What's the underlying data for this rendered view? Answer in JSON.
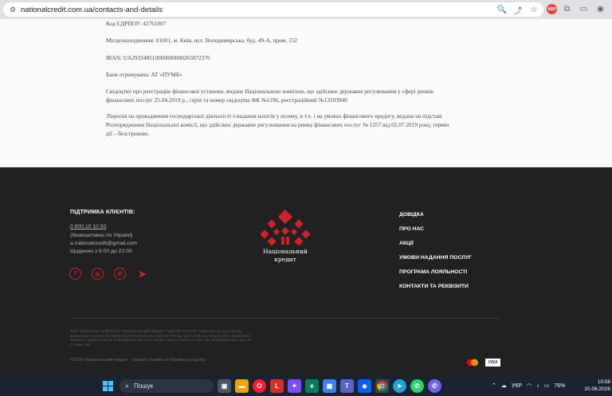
{
  "browser": {
    "url": "nationalcredit.com.ua/contacts-and-details"
  },
  "content": {
    "paragraphs": [
      "Код ЄДРПОУ: 42761807",
      "Місцезнаходження: 01001, м. Київ, вул. Володимирська, буд. 49-А, прим. 152",
      "IBAN: UA293348510000000000265072376",
      "Банк отримувача: АТ «ПУМБ»",
      "Свідоцтво про реєстрацію фінансової установи, видане Національною комісією, що здійснює державне регулювання у сфері ринків фінансових послуг 25.04.2019 р., серія та номер свідоцтва ФК №1196, реєстраційний №13103940",
      "Ліцензія на провадження господарської діяльності з надання коштів у позику, в т.ч. і на умовах фінансового кредиту, видана на підставі Розпорядження Національної комісії, що здійснює державне регулювання на ринку фінансових послуг № 1257 від 02.07.2019 року, термін дії – безстроково."
    ]
  },
  "footer": {
    "support_title": "ПІДТРИМКА КЛІЄНТІВ:",
    "phone": "0 800 10 10 50",
    "phone_note": "(безкоштовно по Україні)",
    "email": "a.nationalcredit@gmail.com",
    "hours": "Щоденно з 8:00 до 22:00",
    "socials": [
      "facebook-icon",
      "instagram-icon",
      "viber-icon",
      "telegram-icon"
    ],
    "logo_line1": "Національний",
    "logo_line2": "кредит",
    "menu": [
      "ДОВІДКА",
      "ПРО НАС",
      "АКЦІЇ",
      "УМОВИ НАДАННЯ ПОСЛУГ",
      "ПРОГРАМА ЛОЯЛЬНОСТІ",
      "КОНТАКТИ ТА РЕКВІЗИТИ"
    ],
    "legal_text": "ТОВ \"ФІНАНСОВА КОМПАНІЯ \"НАЦІОНАЛЬНИЙ КРЕДИТ\" ЄДРПОУ 42761807 Свідоцтво про реєстрацію фінансової установи ФК №1196 від 25.04.2019 року Ліцензія НБУ від 02.07.2019 року на діяльність фінансової компанії з надання коштів та банківських металів у кредит Адреса: 01001, м. Київ, вул. Володимирська, буд. 49-А, прим. 152",
    "copyright": "©2026 Національний кредит – Кредит онлайн на банківську картку",
    "visa": "VISA",
    "brand_red": "#c7272c",
    "bg": "#222020"
  },
  "taskbar": {
    "search_label": "Пошук",
    "lang": "УКР",
    "battery": "76%",
    "time": "10:58",
    "date": "20.06.2026"
  }
}
